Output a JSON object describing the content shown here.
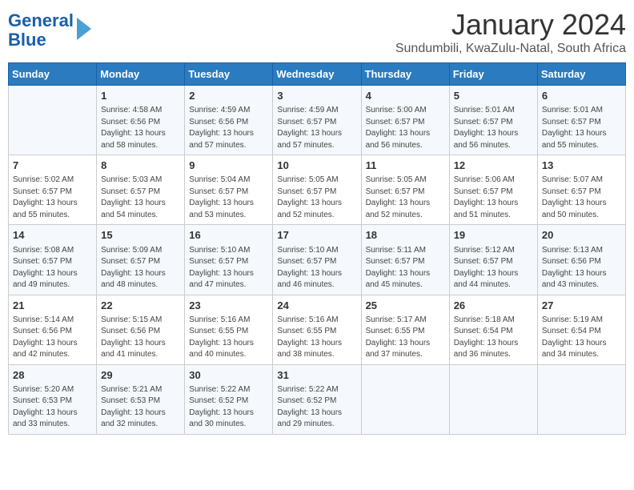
{
  "logo": {
    "line1": "General",
    "line2": "Blue"
  },
  "title": "January 2024",
  "subtitle": "Sundumbili, KwaZulu-Natal, South Africa",
  "days": [
    "Sunday",
    "Monday",
    "Tuesday",
    "Wednesday",
    "Thursday",
    "Friday",
    "Saturday"
  ],
  "weeks": [
    [
      {
        "day": "",
        "content": ""
      },
      {
        "day": "1",
        "content": "Sunrise: 4:58 AM\nSunset: 6:56 PM\nDaylight: 13 hours\nand 58 minutes."
      },
      {
        "day": "2",
        "content": "Sunrise: 4:59 AM\nSunset: 6:56 PM\nDaylight: 13 hours\nand 57 minutes."
      },
      {
        "day": "3",
        "content": "Sunrise: 4:59 AM\nSunset: 6:57 PM\nDaylight: 13 hours\nand 57 minutes."
      },
      {
        "day": "4",
        "content": "Sunrise: 5:00 AM\nSunset: 6:57 PM\nDaylight: 13 hours\nand 56 minutes."
      },
      {
        "day": "5",
        "content": "Sunrise: 5:01 AM\nSunset: 6:57 PM\nDaylight: 13 hours\nand 56 minutes."
      },
      {
        "day": "6",
        "content": "Sunrise: 5:01 AM\nSunset: 6:57 PM\nDaylight: 13 hours\nand 55 minutes."
      }
    ],
    [
      {
        "day": "7",
        "content": "Sunrise: 5:02 AM\nSunset: 6:57 PM\nDaylight: 13 hours\nand 55 minutes."
      },
      {
        "day": "8",
        "content": "Sunrise: 5:03 AM\nSunset: 6:57 PM\nDaylight: 13 hours\nand 54 minutes."
      },
      {
        "day": "9",
        "content": "Sunrise: 5:04 AM\nSunset: 6:57 PM\nDaylight: 13 hours\nand 53 minutes."
      },
      {
        "day": "10",
        "content": "Sunrise: 5:05 AM\nSunset: 6:57 PM\nDaylight: 13 hours\nand 52 minutes."
      },
      {
        "day": "11",
        "content": "Sunrise: 5:05 AM\nSunset: 6:57 PM\nDaylight: 13 hours\nand 52 minutes."
      },
      {
        "day": "12",
        "content": "Sunrise: 5:06 AM\nSunset: 6:57 PM\nDaylight: 13 hours\nand 51 minutes."
      },
      {
        "day": "13",
        "content": "Sunrise: 5:07 AM\nSunset: 6:57 PM\nDaylight: 13 hours\nand 50 minutes."
      }
    ],
    [
      {
        "day": "14",
        "content": "Sunrise: 5:08 AM\nSunset: 6:57 PM\nDaylight: 13 hours\nand 49 minutes."
      },
      {
        "day": "15",
        "content": "Sunrise: 5:09 AM\nSunset: 6:57 PM\nDaylight: 13 hours\nand 48 minutes."
      },
      {
        "day": "16",
        "content": "Sunrise: 5:10 AM\nSunset: 6:57 PM\nDaylight: 13 hours\nand 47 minutes."
      },
      {
        "day": "17",
        "content": "Sunrise: 5:10 AM\nSunset: 6:57 PM\nDaylight: 13 hours\nand 46 minutes."
      },
      {
        "day": "18",
        "content": "Sunrise: 5:11 AM\nSunset: 6:57 PM\nDaylight: 13 hours\nand 45 minutes."
      },
      {
        "day": "19",
        "content": "Sunrise: 5:12 AM\nSunset: 6:57 PM\nDaylight: 13 hours\nand 44 minutes."
      },
      {
        "day": "20",
        "content": "Sunrise: 5:13 AM\nSunset: 6:56 PM\nDaylight: 13 hours\nand 43 minutes."
      }
    ],
    [
      {
        "day": "21",
        "content": "Sunrise: 5:14 AM\nSunset: 6:56 PM\nDaylight: 13 hours\nand 42 minutes."
      },
      {
        "day": "22",
        "content": "Sunrise: 5:15 AM\nSunset: 6:56 PM\nDaylight: 13 hours\nand 41 minutes."
      },
      {
        "day": "23",
        "content": "Sunrise: 5:16 AM\nSunset: 6:55 PM\nDaylight: 13 hours\nand 40 minutes."
      },
      {
        "day": "24",
        "content": "Sunrise: 5:16 AM\nSunset: 6:55 PM\nDaylight: 13 hours\nand 38 minutes."
      },
      {
        "day": "25",
        "content": "Sunrise: 5:17 AM\nSunset: 6:55 PM\nDaylight: 13 hours\nand 37 minutes."
      },
      {
        "day": "26",
        "content": "Sunrise: 5:18 AM\nSunset: 6:54 PM\nDaylight: 13 hours\nand 36 minutes."
      },
      {
        "day": "27",
        "content": "Sunrise: 5:19 AM\nSunset: 6:54 PM\nDaylight: 13 hours\nand 34 minutes."
      }
    ],
    [
      {
        "day": "28",
        "content": "Sunrise: 5:20 AM\nSunset: 6:53 PM\nDaylight: 13 hours\nand 33 minutes."
      },
      {
        "day": "29",
        "content": "Sunrise: 5:21 AM\nSunset: 6:53 PM\nDaylight: 13 hours\nand 32 minutes."
      },
      {
        "day": "30",
        "content": "Sunrise: 5:22 AM\nSunset: 6:52 PM\nDaylight: 13 hours\nand 30 minutes."
      },
      {
        "day": "31",
        "content": "Sunrise: 5:22 AM\nSunset: 6:52 PM\nDaylight: 13 hours\nand 29 minutes."
      },
      {
        "day": "",
        "content": ""
      },
      {
        "day": "",
        "content": ""
      },
      {
        "day": "",
        "content": ""
      }
    ]
  ]
}
